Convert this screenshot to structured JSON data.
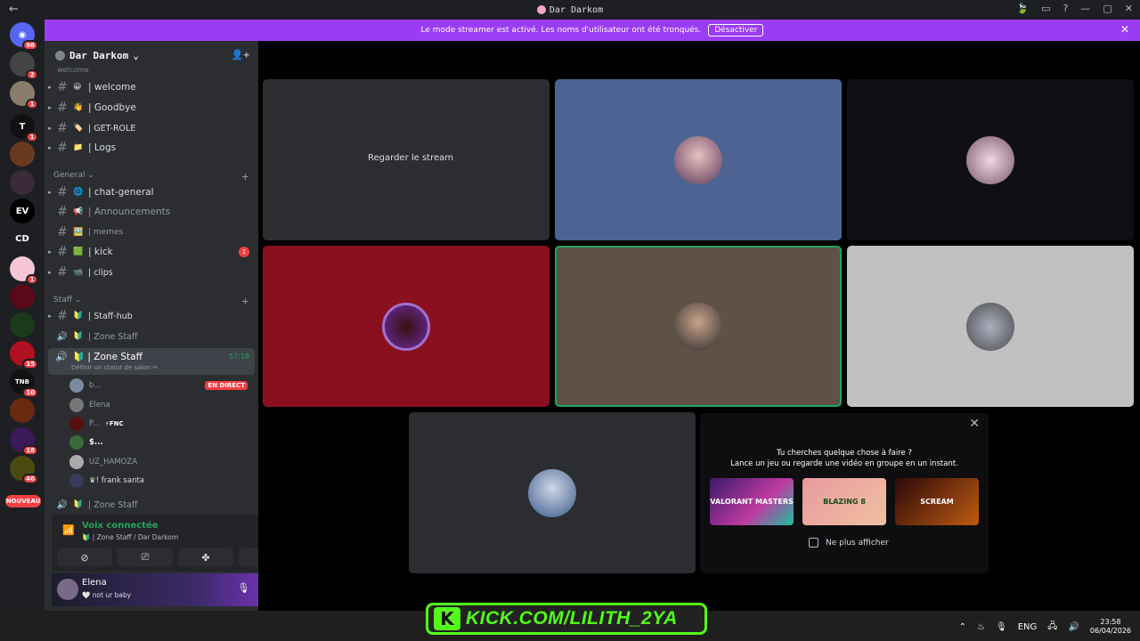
{
  "titlebar": {
    "back": "←",
    "title": "Dar Darkom",
    "icons": [
      "🍃",
      "▭",
      "?",
      "—",
      "▢",
      "✕"
    ]
  },
  "banner": {
    "text": "Le mode streamer est activé. Les noms d'utilisateur ont été tronqués.",
    "button": "Désactiver",
    "close": "✕"
  },
  "rail": {
    "servers": [
      {
        "label": "",
        "badge": "98"
      },
      {
        "label": "",
        "badge": "2"
      },
      {
        "label": "",
        "badge": "1"
      },
      {
        "label": "T",
        "badge": "1"
      },
      {
        "label": "",
        "badge": ""
      },
      {
        "label": "",
        "badge": ""
      },
      {
        "label": "EV",
        "badge": ""
      },
      {
        "label": "CD",
        "badge": ""
      },
      {
        "label": "",
        "badge": "1"
      },
      {
        "label": "",
        "badge": ""
      },
      {
        "label": "",
        "badge": ""
      },
      {
        "label": "",
        "badge": "15"
      },
      {
        "label": "TNB",
        "badge": "10"
      },
      {
        "label": "",
        "badge": ""
      },
      {
        "label": "",
        "badge": "18"
      },
      {
        "label": "",
        "badge": "46"
      }
    ],
    "new_label": "NOUVEAU"
  },
  "guild": {
    "name": "Dar Darkom",
    "top_category": "welcome"
  },
  "channels_welcome": [
    {
      "emoji": "😀",
      "name": "| welcome"
    },
    {
      "emoji": "👋",
      "name": "| Goodbye"
    },
    {
      "emoji": "🏷️",
      "name": "| GET-ROLE"
    },
    {
      "emoji": "📁",
      "name": "| Logs"
    }
  ],
  "cat_general": "General",
  "channels_general": [
    {
      "emoji": "🌐",
      "name": "| chat-general",
      "badge": ""
    },
    {
      "emoji": "📢",
      "name": "| Announcements",
      "badge": ""
    },
    {
      "emoji": "🖼️",
      "name": "| memes",
      "badge": ""
    },
    {
      "emoji": "🟩",
      "name": "| kick",
      "badge": "1"
    },
    {
      "emoji": "📹",
      "name": "| clips",
      "badge": ""
    }
  ],
  "cat_staff": "Staff",
  "staff_hub": {
    "emoji": "🔰",
    "name": "| Staff-hub"
  },
  "zone_staff_1": {
    "emoji": "🔰",
    "name": "| Zone Staff"
  },
  "active_vc": {
    "emoji": "🔰",
    "name": "| Zone Staff",
    "timer": "57:18",
    "sub": "Définir un statut de salon ✏"
  },
  "vc_users": [
    {
      "name": "b...",
      "live": "EN DIRECT",
      "tag": ""
    },
    {
      "name": "Elena",
      "live": "",
      "tag": ""
    },
    {
      "name": "P...",
      "live": "",
      "tag": "⚡FNC"
    },
    {
      "name": "$...",
      "live": "",
      "tag": ""
    },
    {
      "name": "UZ_HAMOZA",
      "live": "",
      "tag": ""
    },
    {
      "name": "♛! frank santa",
      "live": "",
      "tag": ""
    }
  ],
  "zone_staff_2": {
    "emoji": "🔰",
    "name": "| Zone Staff"
  },
  "voice_panel": {
    "status": "Voix connectée",
    "sub": "🔰 | Zone Staff / Dar Darkom"
  },
  "user": {
    "name": "Elena",
    "status": "🤍 not ur baby"
  },
  "tiles": {
    "watch_label": "Regarder le stream"
  },
  "suggest": {
    "line1": "Tu cherches quelque chose à faire ?",
    "line2": "Lance un jeu ou regarde une vidéo en groupe en un instant.",
    "games": [
      "VALORANT MASTERS",
      "BLAZING 8",
      "SCREAM"
    ],
    "checkbox": "Ne plus afficher"
  },
  "taskbar": {
    "lang": "ENG",
    "time": "23:58",
    "date": "06/04/2026"
  },
  "overlay": {
    "kick_url": "KICK.COM/LILITH_2YA"
  }
}
